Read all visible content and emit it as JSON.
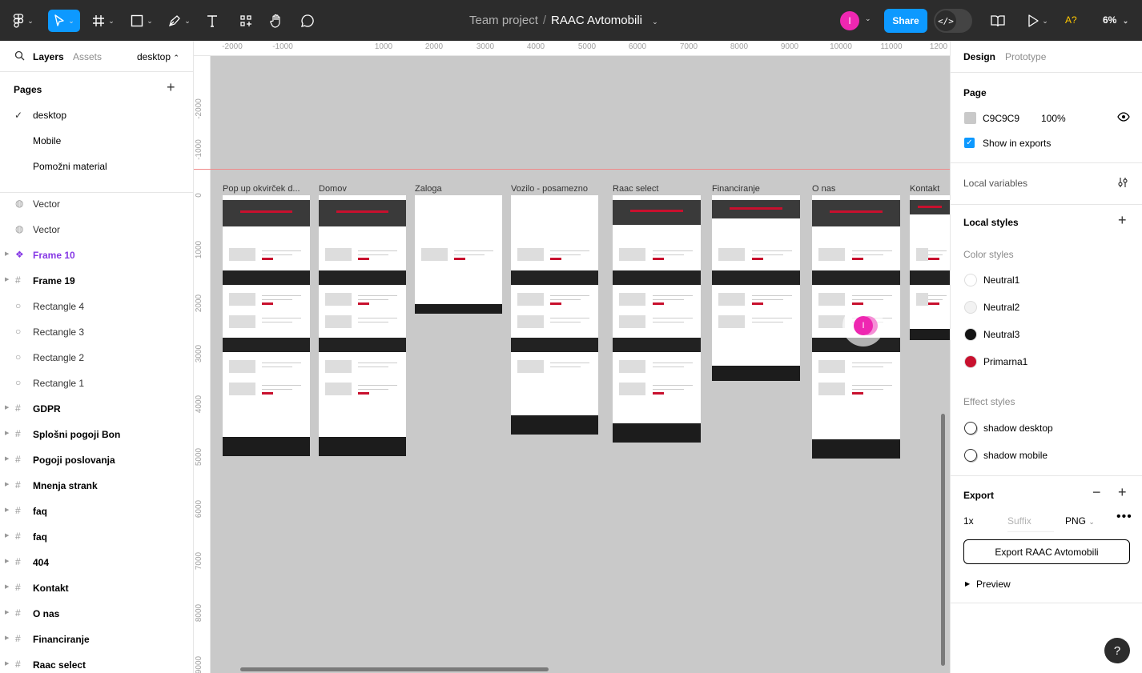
{
  "toolbar": {
    "project": "Team project",
    "separator": "/",
    "file_name": "RAAC Avtomobili",
    "avatar_initial": "I",
    "share_label": "Share",
    "dev_mode_label": "</>",
    "warning_label": "A?",
    "zoom_label": "6%"
  },
  "left_panel": {
    "tab_layers": "Layers",
    "tab_assets": "Assets",
    "page_selector": "desktop",
    "pages_heading": "Pages",
    "pages": [
      "desktop",
      "Mobile",
      "Pomožni material"
    ],
    "layers": [
      {
        "name": "Vector",
        "type": "vector"
      },
      {
        "name": "Vector",
        "type": "vector"
      },
      {
        "name": "Frame 10",
        "type": "component"
      },
      {
        "name": "Frame 19",
        "type": "frame"
      },
      {
        "name": "Rectangle 4",
        "type": "ellipse"
      },
      {
        "name": "Rectangle 3",
        "type": "ellipse"
      },
      {
        "name": "Rectangle 2",
        "type": "ellipse"
      },
      {
        "name": "Rectangle 1",
        "type": "ellipse"
      },
      {
        "name": "GDPR",
        "type": "frame"
      },
      {
        "name": "Splošni pogoji Bon",
        "type": "frame"
      },
      {
        "name": "Pogoji poslovanja",
        "type": "frame"
      },
      {
        "name": "Mnenja strank",
        "type": "frame"
      },
      {
        "name": "faq",
        "type": "frame"
      },
      {
        "name": "faq",
        "type": "frame"
      },
      {
        "name": "404",
        "type": "frame"
      },
      {
        "name": "Kontakt",
        "type": "frame"
      },
      {
        "name": "O nas",
        "type": "frame"
      },
      {
        "name": "Financiranje",
        "type": "frame"
      },
      {
        "name": "Raac select",
        "type": "frame"
      }
    ]
  },
  "canvas": {
    "background": "#C9C9C9",
    "ruler_top": [
      "-2000",
      "-1000",
      "1000",
      "2000",
      "3000",
      "4000",
      "5000",
      "6000",
      "7000",
      "8000",
      "9000",
      "10000",
      "11000",
      "1200"
    ],
    "ruler_left": [
      "-2000",
      "-1000",
      "0",
      "1000",
      "2000",
      "3000",
      "4000",
      "5000",
      "6000",
      "7000",
      "8000",
      "9000"
    ],
    "frames": [
      "Pop up okvirček d...",
      "Domov",
      "Zaloga",
      "Vozilo - posamezno",
      "Raac select",
      "Financiranje",
      "O nas",
      "Kontakt"
    ],
    "cursor_initial": "I"
  },
  "right_panel": {
    "tab_design": "Design",
    "tab_prototype": "Prototype",
    "page_heading": "Page",
    "page_color_hex": "C9C9C9",
    "page_opacity": "100%",
    "show_in_exports": "Show in exports",
    "local_variables": "Local variables",
    "local_styles": "Local styles",
    "color_styles_heading": "Color styles",
    "color_styles": [
      {
        "name": "Neutral1",
        "color": "#FFFFFF"
      },
      {
        "name": "Neutral2",
        "color": "#F2F2F2"
      },
      {
        "name": "Neutral3",
        "color": "#141414"
      },
      {
        "name": "Primarna1",
        "color": "#C8102E"
      }
    ],
    "effect_styles_heading": "Effect styles",
    "effect_styles": [
      "shadow desktop",
      "shadow mobile"
    ],
    "export_heading": "Export",
    "export_scale": "1x",
    "export_suffix_placeholder": "Suffix",
    "export_format": "PNG",
    "export_button": "Export RAAC Avtomobili",
    "preview_label": "Preview",
    "help_label": "?"
  },
  "colors": {
    "accent": "#0D99FF",
    "toolbar_bg": "#2C2C2C",
    "brand_red": "#C8102E",
    "avatar": "#EE27B1"
  }
}
